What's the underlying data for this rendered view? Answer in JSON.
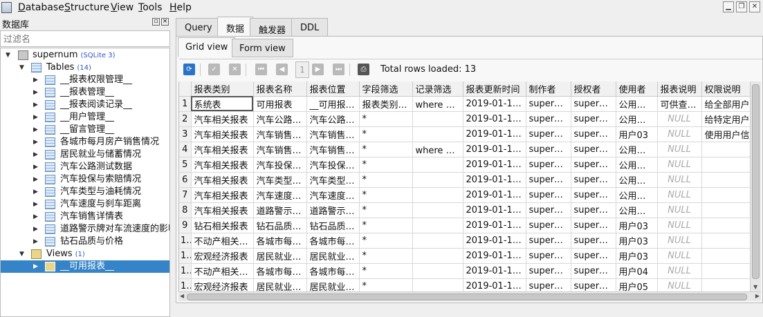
{
  "menu": [
    "Database",
    "Structure",
    "View",
    "Tools",
    "Help"
  ],
  "left_panel": {
    "title": "数据库",
    "filter_placeholder": "过滤名",
    "db_name": "supernum",
    "db_type": "(SQLite 3)",
    "tables_label": "Tables",
    "tables_count": "(14)",
    "tables": [
      "__报表权限管理__",
      "__报表管理__",
      "__报表阅读记录__",
      "__用户管理__",
      "__留言管理__",
      "各城市每月房产销售情况",
      "居民就业与储蓄情况",
      "汽车公路测试数据",
      "汽车投保与索赔情况",
      "汽车类型与油耗情况",
      "汽车速度与刹车距离",
      "汽车销售详情表",
      "道路警示牌对车流速度的影响",
      "钻石品质与价格"
    ],
    "views_label": "Views",
    "views_count": "(1)",
    "views": [
      "__可用报表__"
    ]
  },
  "tabs": [
    "Query",
    "数据",
    "触发器",
    "DDL"
  ],
  "active_tab": "数据",
  "subtabs": [
    "Grid view",
    "Form view"
  ],
  "active_subtab": "Grid view",
  "toolbar": {
    "page_number": "1",
    "rows_loaded": "Total rows loaded: 13"
  },
  "grid": {
    "columns": [
      "报表类别",
      "报表名称",
      "报表位置",
      "字段筛选",
      "记录筛选",
      "报表更新时间",
      "制作者",
      "授权者",
      "使用者",
      "报表说明",
      "权限说明"
    ],
    "rows": [
      [
        "1",
        "系统表",
        "可用报表",
        "__可用报…",
        "报表类别, …",
        "where 使…",
        "2019-01-16 1…",
        "supernum",
        "supernum",
        "公用账号",
        "可供查…",
        "给全部用户赋"
      ],
      [
        "2",
        "汽车相关报表",
        "汽车公路…",
        "汽车公路…",
        "*",
        "",
        "2019-01-16 1…",
        "supernum",
        "supernum",
        "公用账号",
        "NULL",
        "给特定用户赋"
      ],
      [
        "3",
        "汽车相关报表",
        "汽车销售…",
        "汽车销售…",
        "*",
        "",
        "2019-01-16 1…",
        "supernum",
        "supernum",
        "用户03",
        "NULL",
        "使用用户信息"
      ],
      [
        "4",
        "汽车相关报表",
        "汽车销售…",
        "汽车销售…",
        "*",
        "where 销…",
        "2019-01-16 1…",
        "supernum",
        "supernum",
        "公用账号",
        "NULL",
        ""
      ],
      [
        "5",
        "汽车相关报表",
        "汽车投保…",
        "汽车投保…",
        "*",
        "",
        "2019-01-16 1…",
        "supernum",
        "supernum",
        "公用账号",
        "NULL",
        ""
      ],
      [
        "6",
        "汽车相关报表",
        "汽车类型…",
        "汽车类型…",
        "*",
        "",
        "2019-01-16 1…",
        "supernum",
        "supernum",
        "公用账号",
        "NULL",
        ""
      ],
      [
        "7",
        "汽车相关报表",
        "汽车速度…",
        "汽车速度…",
        "*",
        "",
        "2019-01-16 1…",
        "supernum",
        "supernum",
        "公用账号",
        "NULL",
        ""
      ],
      [
        "8",
        "汽车相关报表",
        "道路警示…",
        "道路警示…",
        "*",
        "",
        "2019-01-16 1…",
        "supernum",
        "supernum",
        "公用账号",
        "NULL",
        ""
      ],
      [
        "9",
        "钻石相关报表",
        "钻石品质…",
        "钻石品质…",
        "*",
        "",
        "2019-01-16 1…",
        "supernum",
        "supernum",
        "用户03",
        "NULL",
        ""
      ],
      [
        "10",
        "不动产相关…",
        "各城市每…",
        "各城市每…",
        "*",
        "",
        "2019-01-16 1…",
        "supernum",
        "supernum",
        "用户03",
        "NULL",
        ""
      ],
      [
        "11",
        "宏观经济报表",
        "居民就业…",
        "居民就业…",
        "*",
        "",
        "2019-01-16 1…",
        "supernum",
        "supernum",
        "用户03",
        "NULL",
        ""
      ],
      [
        "12",
        "不动产相关…",
        "各城市每…",
        "各城市每…",
        "*",
        "",
        "2019-01-16 1…",
        "supernum",
        "supernum",
        "用户04",
        "NULL",
        ""
      ],
      [
        "13",
        "宏观经济报表",
        "居民就业…",
        "居民就业…",
        "*",
        "",
        "2019-01-16 1…",
        "supernum",
        "supernum",
        "用户05",
        "NULL",
        ""
      ]
    ]
  }
}
